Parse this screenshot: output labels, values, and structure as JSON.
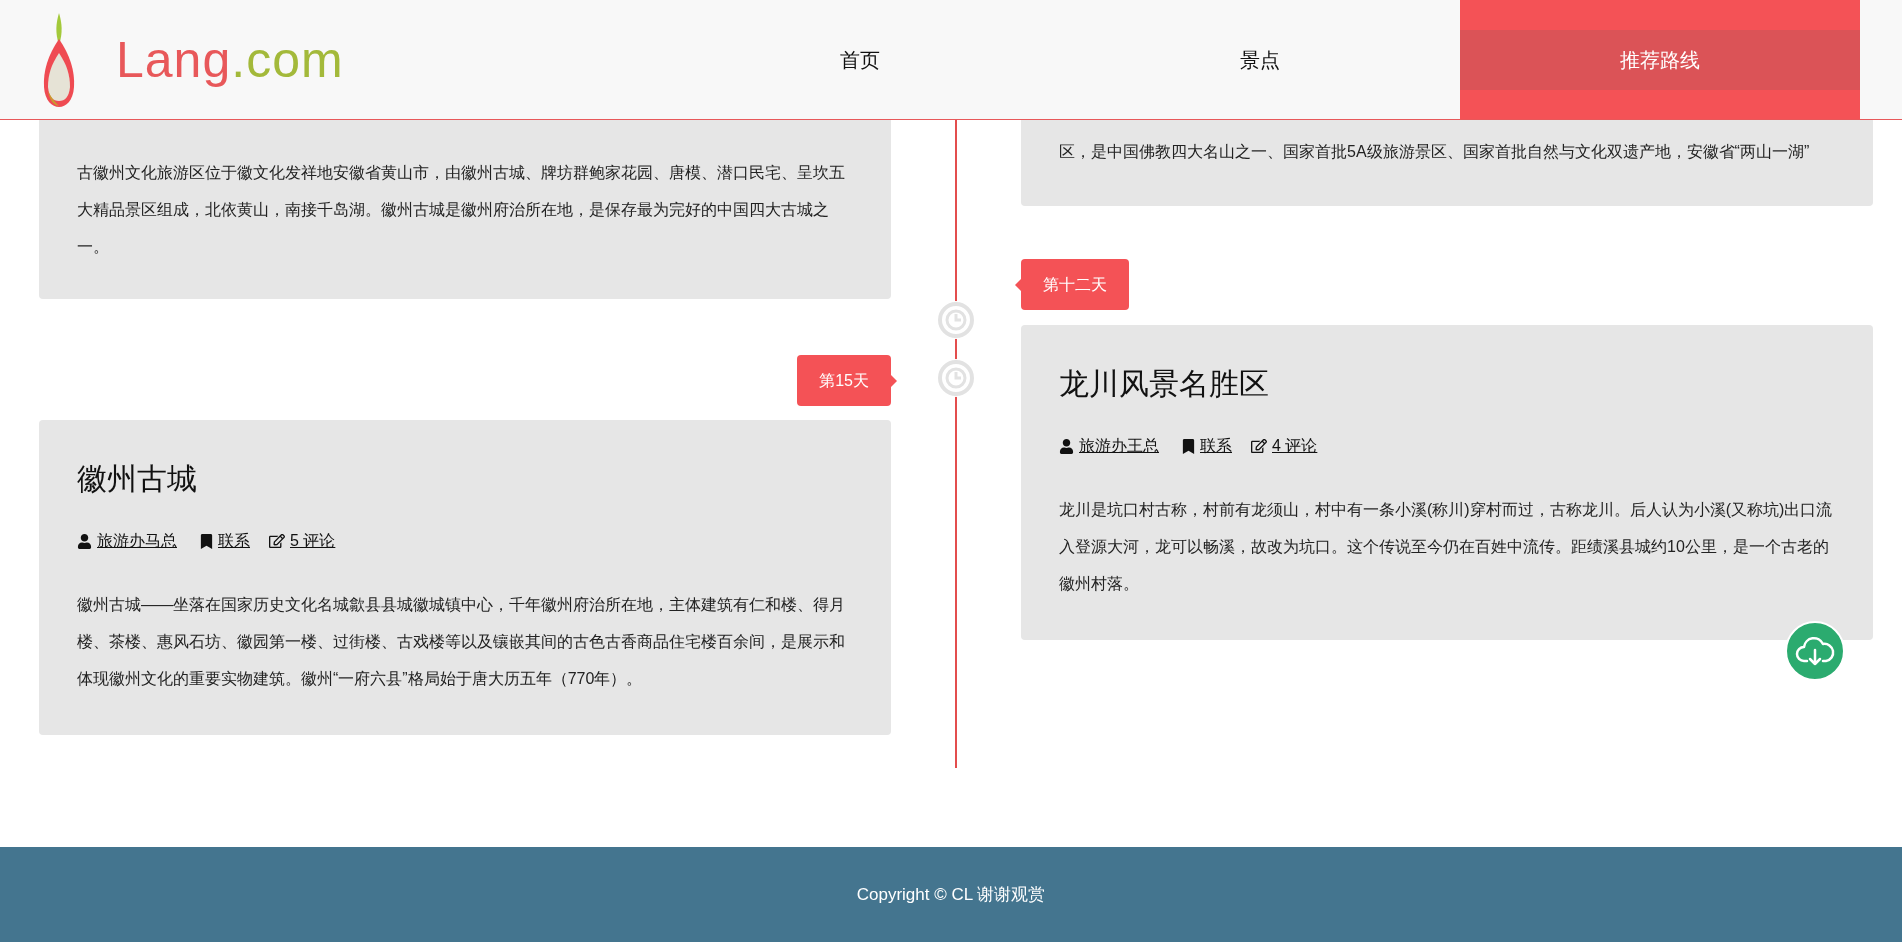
{
  "header": {
    "logo": {
      "name": "Lang",
      "suffix": ".com"
    },
    "nav": [
      {
        "label": "首页",
        "selected": false
      },
      {
        "label": "景点",
        "selected": false
      },
      {
        "label": "推荐路线",
        "selected": true
      }
    ]
  },
  "timeline": {
    "left": [
      {
        "kind": "card",
        "text": "古徽州文化旅游区位于徽文化发祥地安徽省黄山市，由徽州古城、牌坊群鲍家花园、唐模、潜口民宅、呈坎五大精品景区组成，北依黄山，南接千岛湖。徽州古城是徽州府治所在地，是保存最为完好的中国四大古城之一。"
      },
      {
        "kind": "badge",
        "label": "第15天"
      },
      {
        "kind": "card",
        "title": "徽州古城",
        "author": "旅游办马总",
        "contact": "联系",
        "comments": "5 评论",
        "text": "徽州古城——坐落在国家历史文化名城歙县县城徽城镇中心，千年徽州府治所在地，主体建筑有仁和楼、得月楼、茶楼、惠风石坊、徽园第一楼、过街楼、古戏楼等以及镶嵌其间的古色古香商品住宅楼百余间，是展示和体现徽州文化的重要实物建筑。徽州“一府六县”格局始于唐大历五年（770年）。"
      }
    ],
    "right": [
      {
        "kind": "card",
        "text": "区，是中国佛教四大名山之一、国家首批5A级旅游景区、国家首批自然与文化双遗产地，安徽省“两山一湖”"
      },
      {
        "kind": "badge",
        "label": "第十二天"
      },
      {
        "kind": "card",
        "title": "龙川风景名胜区",
        "author": "旅游办王总",
        "contact": "联系",
        "comments": "4 评论",
        "text": "龙川是坑口村古称，村前有龙须山，村中有一条小溪(称川)穿村而过，古称龙川。后人认为小溪(又称坑)出口流入登源大河，龙可以畅溪，故改为坑口。这个传说至今仍在百姓中流传。距绩溪县城约10公里，是一个古老的徽州村落。"
      }
    ]
  },
  "footer": {
    "copyright": "Copyright © CL 谢谢观赏"
  }
}
